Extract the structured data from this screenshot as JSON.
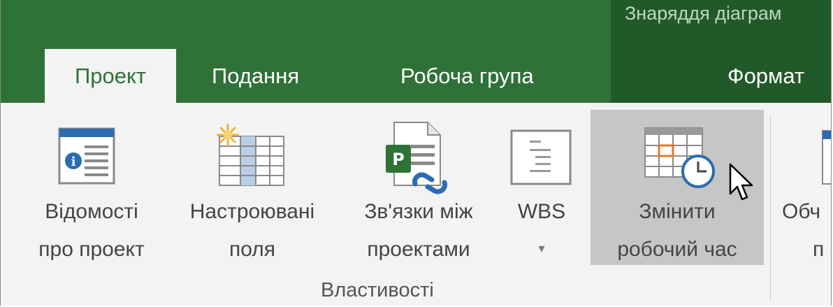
{
  "ribbon": {
    "context_title": "Знаряддя діаграм",
    "tabs": [
      {
        "label": "Проект",
        "active": true
      },
      {
        "label": "Подання"
      },
      {
        "label": "Робоча група"
      },
      {
        "label": "Формат"
      }
    ]
  },
  "group": {
    "label": "Властивості",
    "buttons": [
      {
        "line1": "Відомості",
        "line2": "про проект",
        "icon": "project-info-icon"
      },
      {
        "line1": "Настроювані",
        "line2": "поля",
        "icon": "custom-fields-icon"
      },
      {
        "line1": "Зв'язки між",
        "line2": "проектами",
        "icon": "links-between-projects-icon"
      },
      {
        "line1": "WBS",
        "dropdown": "▾",
        "icon": "wbs-icon"
      },
      {
        "line1": "Змінити",
        "line2": "робочий час",
        "icon": "change-working-time-icon",
        "hovered": true
      }
    ],
    "next_button_partial": {
      "line1": "Обч",
      "line2": "п"
    }
  },
  "colors": {
    "ribbon_green": "#2e7237",
    "context_green": "#215a28",
    "ribbon_bg": "#f3f3f3",
    "hover": "#c6c6c6"
  }
}
